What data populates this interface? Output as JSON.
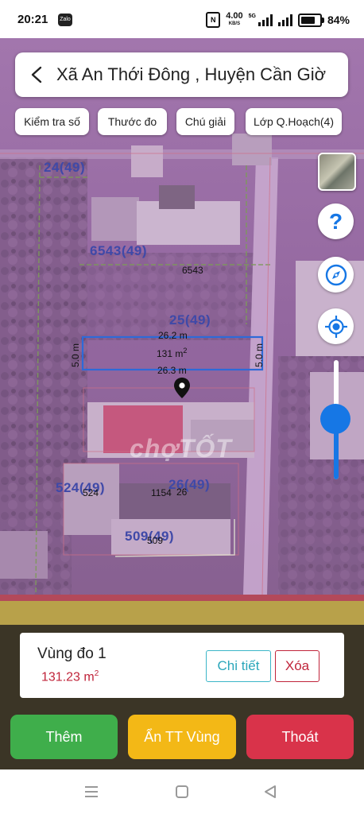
{
  "status_bar": {
    "time": "20:21",
    "notification_app": "Zalo",
    "net_speed": "4.00",
    "net_unit": "KB/S",
    "net_type": "5G",
    "battery": "84%"
  },
  "header": {
    "title": "Xã An Thới Đông , Huyện Cần Giờ"
  },
  "chips": [
    {
      "label": "Kiểm tra số"
    },
    {
      "label": "Thước đo"
    },
    {
      "label": "Chú giải"
    },
    {
      "label": "Lớp Q.Hoạch(4)"
    }
  ],
  "map": {
    "parcel_labels": [
      {
        "text": "24(49)"
      },
      {
        "text": "6543(49)"
      },
      {
        "text": "25(49)"
      },
      {
        "text": "524(49)"
      },
      {
        "text": "26(49)"
      },
      {
        "text": "509(49)"
      }
    ],
    "parcel_numbers": [
      "6543",
      "524",
      "1154",
      "26",
      "509"
    ],
    "measure": {
      "top_length": "26.2 m",
      "bottom_length": "26.3 m",
      "left_width": "5.0 m",
      "right_width": "5.0 m",
      "area": "131 m",
      "area_unit_sup": "2"
    },
    "watermark": "chợTỐT",
    "zoom_level": 0.5
  },
  "panel": {
    "region_title": "Vùng đo 1",
    "region_area": "131.23 m",
    "region_area_sup": "2",
    "detail_label": "Chi tiết",
    "delete_label": "Xóa",
    "add_label": "Thêm",
    "hide_label": "Ẩn TT Vùng",
    "exit_label": "Thoát"
  },
  "colors": {
    "accent_blue": "#1677e5",
    "add_green": "#3fae4b",
    "hide_yellow": "#f3b816",
    "exit_red": "#d9334a",
    "area_red": "#c0243a",
    "detail_teal": "#2aa6ba"
  },
  "icons": {
    "back": "chevron-left-icon",
    "help": "question-icon",
    "compass": "compass-icon",
    "locate": "gps-target-icon",
    "marker": "map-pin-icon",
    "nav_menu": "menu-icon",
    "nav_home": "square-home-icon",
    "nav_back": "triangle-back-icon"
  }
}
